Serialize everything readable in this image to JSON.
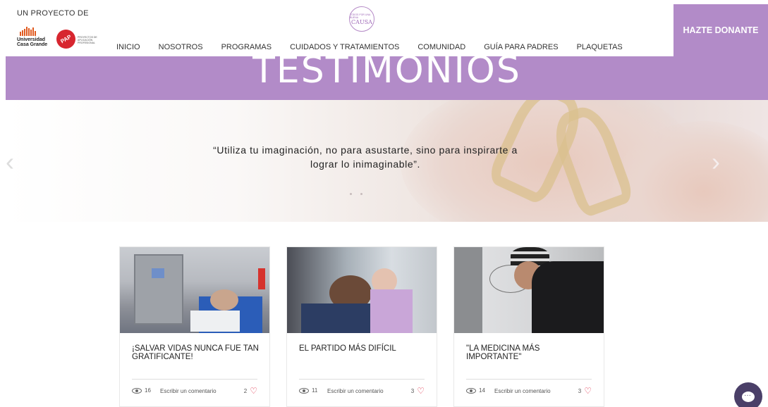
{
  "header": {
    "project_label": "UN PROYECTO DE",
    "ucg_logo_text": "Universidad Casa Grande",
    "pap_logo_text": "PAP",
    "pap_subtext": "PROYECTOS DE APLICACIÓN PROFESIONAL",
    "center_logo_top": "TODOS POR UNA BUENA",
    "center_logo_main": "CAUSA",
    "nav": [
      {
        "label": "INICIO"
      },
      {
        "label": "NOSOTROS"
      },
      {
        "label": "PROGRAMAS"
      },
      {
        "label": "CUIDADOS Y TRATAMIENTOS"
      },
      {
        "label": "COMUNIDAD"
      },
      {
        "label": "GUÍA PARA PADRES"
      },
      {
        "label": "PLAQUETAS"
      }
    ],
    "donate_label": "HAZTE DONANTE"
  },
  "page_title": "TESTIMONIOS",
  "hero": {
    "quote_line1": "“Utiliza tu imaginación, no para asustarte, sino para inspirarte a",
    "quote_line2": "lograr lo inimaginable”.",
    "slide_count": 2
  },
  "posts": [
    {
      "title": "¡SALVAR VIDAS NUNCA FUE TAN GRATIFICANTE!",
      "views": "16",
      "comment_label": "Escribir un comentario",
      "likes": "2"
    },
    {
      "title": "EL PARTIDO MÁS DIFÍCIL",
      "views": "11",
      "comment_label": "Escribir un comentario",
      "likes": "3"
    },
    {
      "title": "\"LA MEDICINA MÁS IMPORTANTE\"",
      "views": "14",
      "comment_label": "Escribir un comentario",
      "likes": "3"
    }
  ],
  "colors": {
    "accent_purple": "#b28bc8",
    "heart_red": "#e0344e",
    "chat_button": "#4a3f68"
  }
}
